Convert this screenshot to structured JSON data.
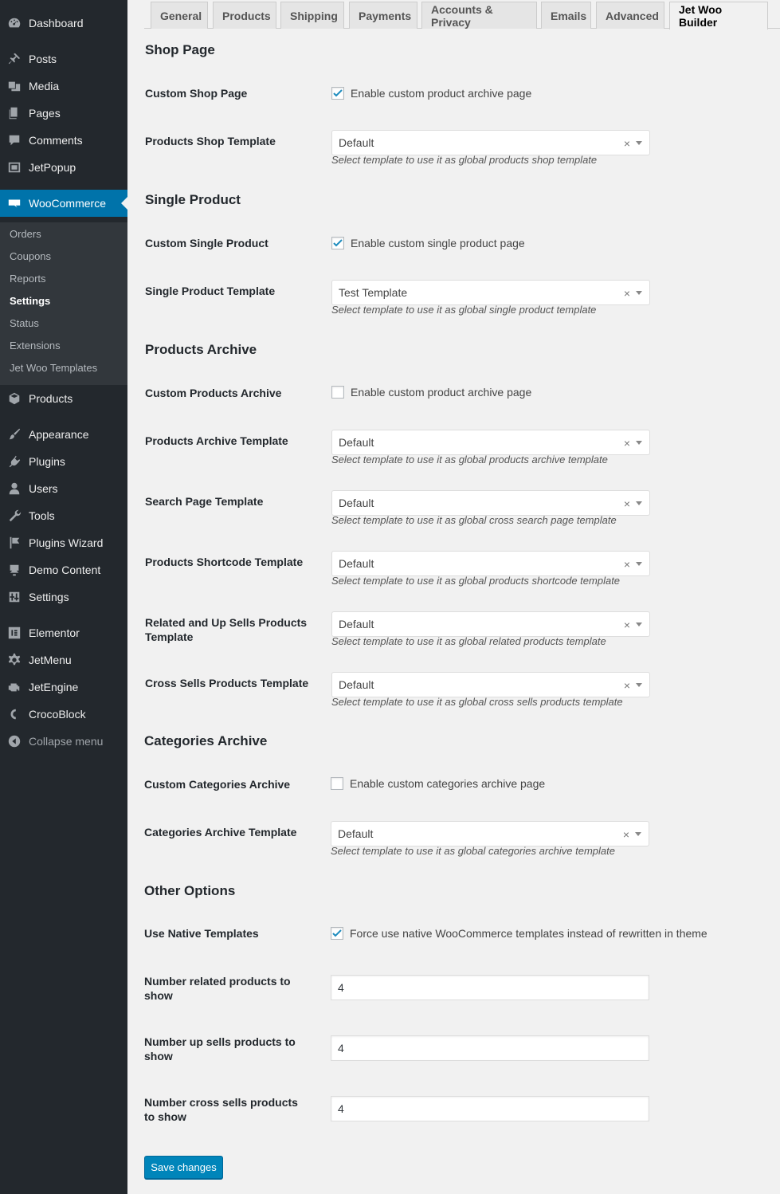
{
  "sidebar": {
    "items": [
      {
        "label": "Dashboard",
        "icon": "dashboard-icon"
      },
      {
        "label": "Posts",
        "icon": "pin-icon"
      },
      {
        "label": "Media",
        "icon": "media-icon"
      },
      {
        "label": "Pages",
        "icon": "pages-icon"
      },
      {
        "label": "Comments",
        "icon": "comment-icon"
      },
      {
        "label": "JetPopup",
        "icon": "popup-icon"
      },
      {
        "label": "WooCommerce",
        "icon": "woo-icon"
      },
      {
        "label": "Products",
        "icon": "box-icon"
      },
      {
        "label": "Appearance",
        "icon": "brush-icon"
      },
      {
        "label": "Plugins",
        "icon": "plug-icon"
      },
      {
        "label": "Users",
        "icon": "user-icon"
      },
      {
        "label": "Tools",
        "icon": "wrench-icon"
      },
      {
        "label": "Plugins Wizard",
        "icon": "flag-icon"
      },
      {
        "label": "Demo Content",
        "icon": "download-icon"
      },
      {
        "label": "Settings",
        "icon": "sliders-icon"
      },
      {
        "label": "Elementor",
        "icon": "elementor-icon"
      },
      {
        "label": "JetMenu",
        "icon": "gear-icon"
      },
      {
        "label": "JetEngine",
        "icon": "engine-icon"
      },
      {
        "label": "CrocoBlock",
        "icon": "croco-icon"
      },
      {
        "label": "Collapse menu",
        "icon": "collapse-icon"
      }
    ],
    "submenu": [
      "Orders",
      "Coupons",
      "Reports",
      "Settings",
      "Status",
      "Extensions",
      "Jet Woo Templates"
    ]
  },
  "tabs": [
    "General",
    "Products",
    "Shipping",
    "Payments",
    "Accounts & Privacy",
    "Emails",
    "Advanced",
    "Jet Woo Builder"
  ],
  "sections": {
    "shop": {
      "title": "Shop Page",
      "custom_label": "Custom Shop Page",
      "custom_checkbox": "Enable custom product archive page",
      "custom_checked": true,
      "template_label": "Products Shop Template",
      "template_value": "Default",
      "template_desc": "Select template to use it as global products shop template"
    },
    "single": {
      "title": "Single Product",
      "custom_label": "Custom Single Product",
      "custom_checkbox": "Enable custom single product page",
      "custom_checked": true,
      "template_label": "Single Product Template",
      "template_value": "Test Template",
      "template_desc": "Select template to use it as global single product template"
    },
    "archive": {
      "title": "Products Archive",
      "custom_label": "Custom Products Archive",
      "custom_checkbox": "Enable custom product archive page",
      "custom_checked": false,
      "fields": [
        {
          "label": "Products Archive Template",
          "value": "Default",
          "desc": "Select template to use it as global products archive template"
        },
        {
          "label": "Search Page Template",
          "value": "Default",
          "desc": "Select template to use it as global cross search page template"
        },
        {
          "label": "Products Shortcode Template",
          "value": "Default",
          "desc": "Select template to use it as global products shortcode template"
        },
        {
          "label": "Related and Up Sells Products Template",
          "value": "Default",
          "desc": "Select template to use it as global related products template"
        },
        {
          "label": "Cross Sells Products Template",
          "value": "Default",
          "desc": "Select template to use it as global cross sells products template"
        }
      ]
    },
    "categories": {
      "title": "Categories Archive",
      "custom_label": "Custom Categories Archive",
      "custom_checkbox": "Enable custom categories archive page",
      "custom_checked": false,
      "template_label": "Categories Archive Template",
      "template_value": "Default",
      "template_desc": "Select template to use it as global categories archive template"
    },
    "other": {
      "title": "Other Options",
      "native_label": "Use Native Templates",
      "native_checkbox": "Force use native WooCommerce templates instead of rewritten in theme",
      "native_checked": true,
      "numbers": [
        {
          "label": "Number related products to show",
          "value": "4"
        },
        {
          "label": "Number up sells products to show",
          "value": "4"
        },
        {
          "label": "Number cross sells products to show",
          "value": "4"
        }
      ]
    }
  },
  "save_label": "Save changes",
  "clear_glyph": "×",
  "colors": {
    "accent": "#0073aa",
    "sidebar": "#23282d",
    "button": "#0085ba"
  }
}
